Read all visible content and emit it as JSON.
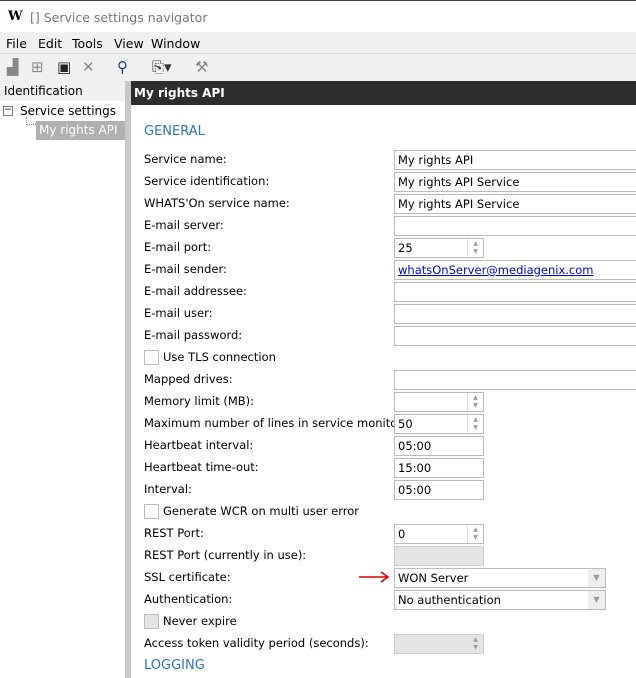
{
  "window": {
    "title": "[] Service settings navigator",
    "logo": "W"
  },
  "menu": [
    "File",
    "Edit",
    "Tools",
    "View",
    "Window"
  ],
  "toolbar": [
    "chart-icon",
    "tree-icon",
    "save-icon",
    "delete-icon",
    "search-icon",
    "report-dropdown-icon",
    "tools-icon"
  ],
  "tree": {
    "header": "Identification",
    "root": "Service settings",
    "child": "My rights API"
  },
  "panel": {
    "title": "My rights API",
    "section": "GENERAL",
    "next_section": "LOGGING"
  },
  "fields": [
    {
      "label": "Service name:",
      "value": "My rights API",
      "type": "text"
    },
    {
      "label": "Service identification:",
      "value": "My rights API Service",
      "type": "text"
    },
    {
      "label": "WHATS'On service name:",
      "value": "My rights API Service",
      "type": "text"
    },
    {
      "label": "E-mail server:",
      "value": "",
      "type": "text"
    },
    {
      "label": "E-mail port:",
      "value": "25",
      "type": "spin"
    },
    {
      "label": "E-mail sender:",
      "value": "whatsOnServer@mediagenix.com",
      "type": "link"
    },
    {
      "label": "E-mail addressee:",
      "value": "",
      "type": "text"
    },
    {
      "label": "E-mail user:",
      "value": "",
      "type": "text"
    },
    {
      "label": "E-mail password:",
      "value": "",
      "type": "text"
    },
    {
      "label": "Use TLS connection",
      "value": false,
      "type": "check"
    },
    {
      "label": "Mapped drives:",
      "value": "",
      "type": "text"
    },
    {
      "label": "Memory limit (MB):",
      "value": "",
      "type": "spin"
    },
    {
      "label": "Maximum number of lines in service monitor:",
      "value": "50",
      "type": "spin"
    },
    {
      "label": "Heartbeat interval:",
      "value": "05:00",
      "type": "short"
    },
    {
      "label": "Heartbeat time-out:",
      "value": "15:00",
      "type": "short"
    },
    {
      "label": "Interval:",
      "value": "05:00",
      "type": "short"
    },
    {
      "label": "Generate WCR on multi user error",
      "value": false,
      "type": "check"
    },
    {
      "label": "REST Port:",
      "value": "0",
      "type": "spin"
    },
    {
      "label": "REST Port (currently in use):",
      "value": "",
      "type": "disabled"
    },
    {
      "label": "SSL certificate:",
      "value": "WON Server",
      "type": "select"
    },
    {
      "label": "Authentication:",
      "value": "No authentication",
      "type": "select"
    },
    {
      "label": "Never expire",
      "value": false,
      "type": "check-disabled"
    },
    {
      "label": "Access token validity period (seconds):",
      "value": "",
      "type": "spin-disabled"
    }
  ],
  "colors": {
    "section": "#2e74b5",
    "header_bg": "#2d2d2d",
    "annotation_arrow": "#e00000"
  }
}
